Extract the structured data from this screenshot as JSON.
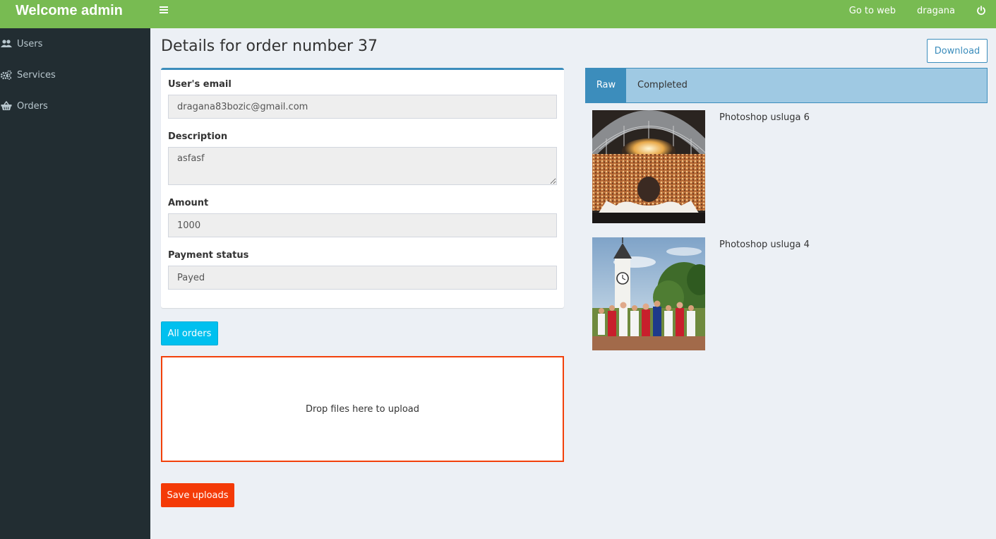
{
  "header": {
    "brand": "Welcome admin",
    "nav": {
      "go_to_web": "Go to web",
      "user": "dragana"
    },
    "accent": "#78bb52"
  },
  "sidebar": {
    "items": [
      {
        "label": "Users",
        "icon": "users-icon"
      },
      {
        "label": "Services",
        "icon": "gears-icon"
      },
      {
        "label": "Orders",
        "icon": "basket-icon"
      }
    ]
  },
  "main": {
    "title": "Details for order number 37",
    "download_label": "Download",
    "form": {
      "email_label": "User's email",
      "email_value": "dragana83bozic@gmail.com",
      "description_label": "Description",
      "description_value": "asfasf",
      "amount_label": "Amount",
      "amount_value": "1000",
      "payment_label": "Payment status",
      "payment_value": "Payed"
    },
    "all_orders_label": "All orders",
    "dropzone_text": "Drop files here to upload",
    "save_label": "Save uploads"
  },
  "tabs": [
    {
      "label": "Raw",
      "active": true
    },
    {
      "label": "Completed",
      "active": false
    }
  ],
  "services": [
    {
      "name": "Photoshop usluga 6",
      "image": "concert-crowd-photo"
    },
    {
      "name": "Photoshop usluga 4",
      "image": "clock-tower-group-photo"
    }
  ]
}
